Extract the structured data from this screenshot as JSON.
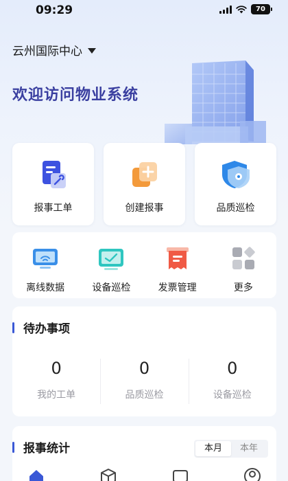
{
  "status_bar": {
    "time": "09:29",
    "battery": "70"
  },
  "header": {
    "location": "云州国际中心",
    "welcome": "欢迎访问物业系统"
  },
  "quick_actions": [
    {
      "label": "报事工单",
      "icon": "work-order-icon"
    },
    {
      "label": "创建报事",
      "icon": "create-report-icon"
    },
    {
      "label": "品质巡检",
      "icon": "quality-inspection-icon"
    }
  ],
  "shortcuts": [
    {
      "label": "离线数据",
      "icon": "offline-data-icon"
    },
    {
      "label": "设备巡检",
      "icon": "device-inspection-icon"
    },
    {
      "label": "发票管理",
      "icon": "invoice-icon"
    },
    {
      "label": "更多",
      "icon": "more-grid-icon"
    }
  ],
  "todo": {
    "title": "待办事项",
    "items": [
      {
        "value": "0",
        "label": "我的工单"
      },
      {
        "value": "0",
        "label": "品质巡检"
      },
      {
        "value": "0",
        "label": "设备巡检"
      }
    ]
  },
  "report_stats": {
    "title": "报事统计",
    "tabs": [
      "本月",
      "本年"
    ],
    "active_tab": "本月"
  },
  "bottom_nav": [
    {
      "icon": "home-icon",
      "active": true
    },
    {
      "icon": "cube-icon",
      "active": false
    },
    {
      "icon": "message-icon",
      "active": false
    },
    {
      "icon": "user-icon",
      "active": false
    }
  ],
  "colors": {
    "accent": "#3a58d6",
    "title": "#3a3fa0",
    "page_bg": "#f3f6fb"
  }
}
